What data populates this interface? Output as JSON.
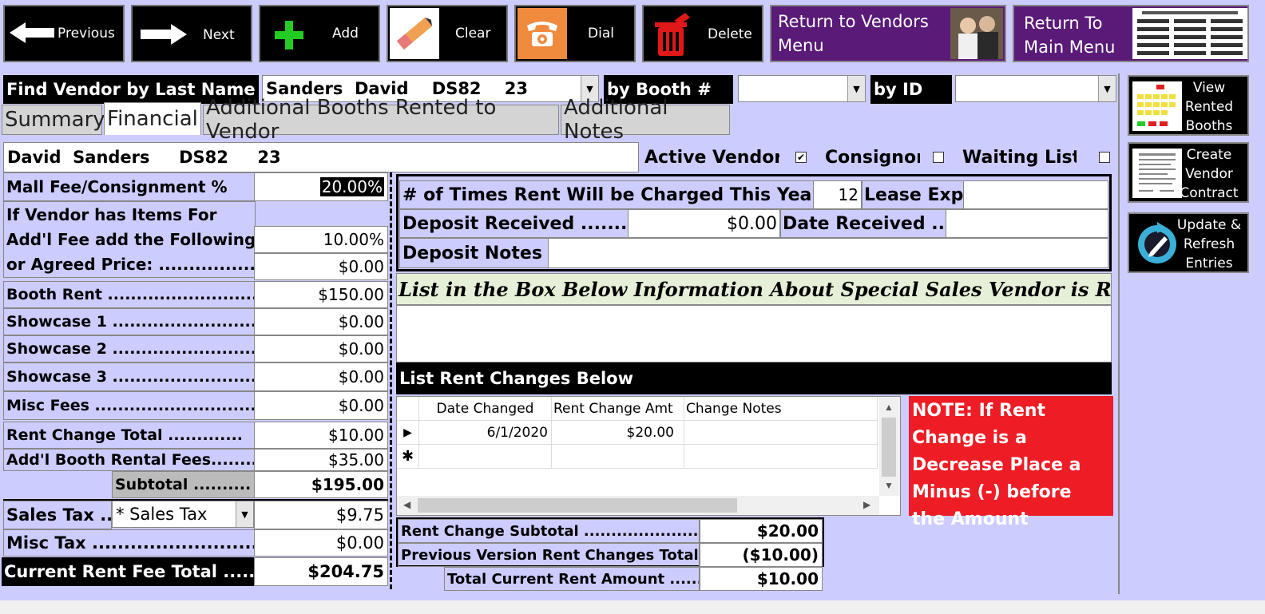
{
  "toolbar": {
    "previous": "Previous",
    "next": "Next",
    "add": "Add",
    "clear": "Clear",
    "dial": "Dial",
    "delete": "Delete",
    "return_vendors": "Return to Vendors Menu",
    "return_main": "Return To Main Menu"
  },
  "find": {
    "by_last_name_label": "Find Vendor by Last Name",
    "last_name_value": "Sanders  David    DS82    23",
    "by_booth_label": "by Booth #",
    "booth_value": "",
    "by_id_label": "by ID",
    "id_value": ""
  },
  "tabs": [
    {
      "label": "Summary"
    },
    {
      "label": "Financial"
    },
    {
      "label": "Additional Booths Rented to Vendor"
    },
    {
      "label": "Additional Notes"
    }
  ],
  "side": {
    "view_rented": "View Rented Booths",
    "create_contract": "Create Vendor Contract",
    "update_refresh": "Update & Refresh Entries"
  },
  "vendor": {
    "name": "David  Sanders     DS82     23",
    "active_label": "Active Vendor",
    "active_checked": "✔",
    "consignor_label": "Consignor",
    "waiting_label": "Waiting List"
  },
  "fees": {
    "mall_fee_label": "Mall Fee/Consignment %",
    "mall_fee_value": "20.00%",
    "items_label_1": "If Vendor has Items For",
    "items_label_2": "Add'l Fee add the Following",
    "items_value": "10.00%",
    "agreed_label": "or Agreed Price: ...................",
    "agreed_value": "$0.00",
    "booth_rent_label": "Booth Rent ..........................",
    "booth_rent_value": "$150.00",
    "showcase1_label": "Showcase 1 .........................",
    "showcase1_value": "$0.00",
    "showcase2_label": "Showcase 2 .........................",
    "showcase2_value": "$0.00",
    "showcase3_label": "Showcase 3 .........................",
    "showcase3_value": "$0.00",
    "misc_fees_label": "Misc Fees .............................",
    "misc_fees_value": "$0.00",
    "rent_change_label": "Rent Change Total .............",
    "rent_change_value": "$10.00",
    "addl_booth_label": "Add'l Booth Rental Fees........",
    "addl_booth_value": "$35.00",
    "subtotal_label": "Subtotal ..........",
    "subtotal_value": "$195.00",
    "sales_tax_label": "Sales Tax ...",
    "sales_tax_select": "* Sales Tax",
    "sales_tax_value": "$9.75",
    "misc_tax_label": "Misc Tax ..............................",
    "misc_tax_value": "$0.00",
    "current_total_label": "Current Rent Fee Total .......",
    "current_total_value": "$204.75"
  },
  "rent_info": {
    "times_label": "# of Times Rent Will be Charged This Year .....",
    "times_value": "12",
    "lease_label": "Lease Exp",
    "lease_value": "",
    "deposit_label": "Deposit Received ...........",
    "deposit_value": "$0.00",
    "date_received_label": "Date Received .....",
    "date_received_value": "",
    "deposit_notes_label": "Deposit Notes",
    "deposit_notes_value": ""
  },
  "special_sales": {
    "heading": "List in the Box Below Information About Special Sales Vendor is Running",
    "value": ""
  },
  "rent_changes": {
    "heading": "List Rent Changes Below",
    "columns": [
      "Date Changed",
      "Rent Change Amt",
      "Change Notes"
    ],
    "rows": [
      {
        "date": "6/1/2020",
        "amount": "$20.00",
        "notes": ""
      }
    ],
    "note": "NOTE: If Rent Change is a Decrease Place a Minus (-) before the Amount",
    "subtotal_label": "Rent Change Subtotal .........................",
    "subtotal_value": "$20.00",
    "previous_label": "Previous Version Rent Changes Total",
    "previous_value": "($10.00)",
    "total_label": "Total Current Rent Amount .......",
    "total_value": "$10.00"
  },
  "colors": {
    "background": "#ccccff",
    "purple_button": "#5a1a78",
    "note_red": "#ee1c24",
    "add_green": "#22cc22"
  }
}
